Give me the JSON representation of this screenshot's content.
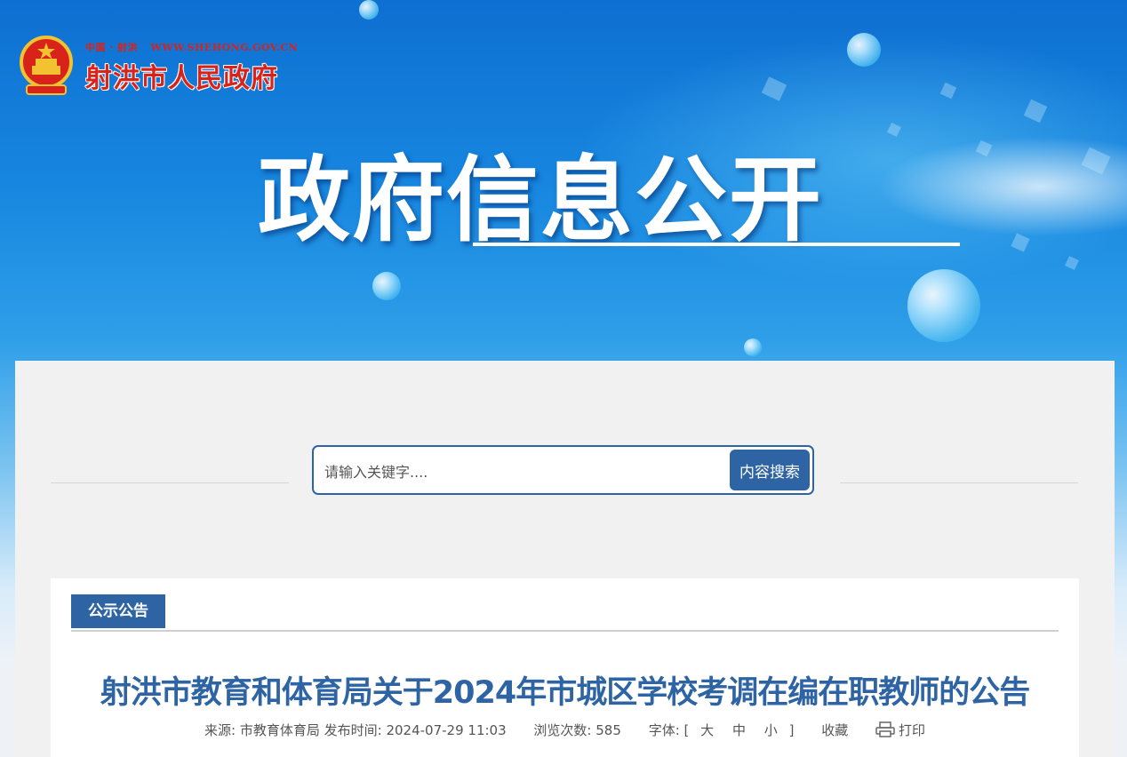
{
  "site": {
    "country_city": "中国 · 射洪",
    "domain": "WWW.SHEHONG.GOV.CN",
    "name": "射洪市人民政府"
  },
  "hero": {
    "title": "政府信息公开"
  },
  "search": {
    "placeholder": "请输入关键字....",
    "button_label": "内容搜索"
  },
  "article": {
    "category_tab": "公示公告",
    "title": "射洪市教育和体育局关于2024年市城区学校考调在编在职教师的公告",
    "meta": {
      "source_label": "来源:",
      "source": "市教育体育局",
      "published_label": "发布时间:",
      "published": "2024-07-29 11:03",
      "views_label": "浏览次数:",
      "views": "585",
      "font_label": "字体:",
      "bracket_open": "[",
      "font_large": "大",
      "font_medium": "中",
      "font_small": "小",
      "bracket_close": "]",
      "favorite": "收藏",
      "print": "打印"
    }
  },
  "colors": {
    "accent": "#2e64a4",
    "logo_red": "#d8231a"
  }
}
